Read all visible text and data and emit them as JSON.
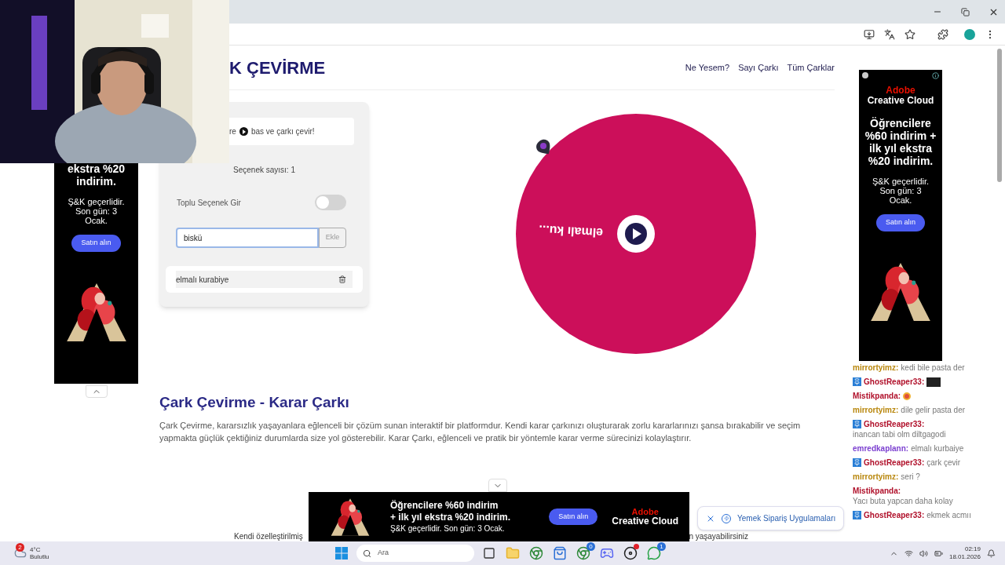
{
  "site": {
    "logo": "K ÇEVİRME",
    "nav": [
      "Ne Yesem?",
      "Sayı Çarkı",
      "Tüm Çarklar"
    ]
  },
  "panel": {
    "hint_before": "re",
    "hint_after": "bas ve çarkı çevir!",
    "count": "Seçenek sayısı: 1",
    "bulk_label": "Toplu Seçenek Gir",
    "bulk_on": false,
    "input": {
      "value": "biskü",
      "focused": true
    },
    "add_button": "Ekle",
    "options": [
      {
        "label": "elmalı kurabiye"
      }
    ]
  },
  "wheel": {
    "segments": [
      {
        "label": "elmalı ku...",
        "color": "#cc0f5a"
      }
    ]
  },
  "article": {
    "title": "Çark Çevirme - Karar Çarkı",
    "paragraph": "Çark Çevirme, kararsızlık yaşayanlara eğlenceli bir çözüm sunan interaktif bir platformdur. Kendi karar çarkınızı oluşturarak zorlu kararlarınızı şansa bırakabilir ve seçim yapmakta güçlük çektiğiniz durumlarda size yol gösterebilir. Karar Çarkı, eğlenceli ve pratik bir yöntemle karar verme sürecinizi kolaylaştırır.",
    "footer_left": "Kendi özelleştirilmiş",
    "footer_right": "n yaşayabilirsiniz"
  },
  "left_ad": {
    "headline": "ekstra %20 indirim.",
    "note": "Ş&K geçerlidir. Son gün: 3 Ocak.",
    "button": "Satın alın"
  },
  "right_ad": {
    "brand": "Adobe",
    "product": "Creative Cloud",
    "headline": "Öğrencilere %60 indirim + ilk yıl ekstra %20 indirim.",
    "note": "Ş&K geçerlidir. Son gün: 3 Ocak.",
    "button": "Satın alın"
  },
  "bottom_ad": {
    "headline_lines": [
      "Öğrencilere %60 indirim",
      "+ ilk yıl ekstra %20 indirim."
    ],
    "note": "Ş&K geçerlidir. Son gün: 3 Ocak.",
    "button": "Satın alın",
    "brand": "Adobe",
    "product": "Creative Cloud"
  },
  "toast": {
    "text": "Yemek Sipariş Uygulamaları"
  },
  "chat": [
    {
      "user": "mirrortyimz:",
      "color": "#b8860b",
      "badge": false,
      "kind": "text",
      "message": "kedi bile pasta der"
    },
    {
      "user": "GhostReaper33:",
      "color": "#b0102a",
      "badge": true
    },
    {
      "user": "Mistikpanda:",
      "color": "#b0102a",
      "badge": false,
      "kind": "emoji"
    },
    {
      "user": "mirrortyimz:",
      "color": "#b8860b",
      "badge": false,
      "kind": "text",
      "message": "dile gelir pasta der"
    },
    {
      "user": "GhostReaper33:",
      "color": "#b0102a",
      "badge": true,
      "kind": "text",
      "message": "inancan tabi olm diltgagodi"
    },
    {
      "user": "emredkaplann:",
      "color": "#7b3fd0",
      "badge": false,
      "kind": "text",
      "message": "elmalı kurbaiye"
    },
    {
      "user": "GhostReaper33:",
      "color": "#b0102a",
      "badge": true,
      "kind": "text",
      "message": "çark çevir"
    },
    {
      "user": "mirrortyimz:",
      "color": "#b8860b",
      "badge": false,
      "kind": "text",
      "message": "seri ?"
    },
    {
      "user": "Mistikpanda:",
      "color": "#b0102a",
      "badge": false,
      "kind": "text",
      "message": "Yacı buta yapcan daha kolay"
    },
    {
      "user": "GhostReaper33:",
      "color": "#b0102a",
      "badge": true,
      "kind": "text",
      "message": "ekmek acmıı"
    }
  ],
  "taskbar": {
    "weather": {
      "temp": "4°C",
      "condition": "Bulutlu",
      "badge": "2"
    },
    "search_placeholder": "Ara",
    "apps": [
      {
        "kind": "taskview",
        "dot": false
      },
      {
        "kind": "files",
        "dot": false
      },
      {
        "kind": "chrome",
        "dot": false
      },
      {
        "kind": "store",
        "dot": false
      },
      {
        "kind": "chrome",
        "badge": "0",
        "dot": false
      },
      {
        "kind": "discord",
        "dot": false
      },
      {
        "kind": "app",
        "dot": true
      },
      {
        "kind": "whatsapp",
        "badge": "1",
        "dot": false
      }
    ],
    "time": "02:19",
    "date": "18.01.2026"
  }
}
